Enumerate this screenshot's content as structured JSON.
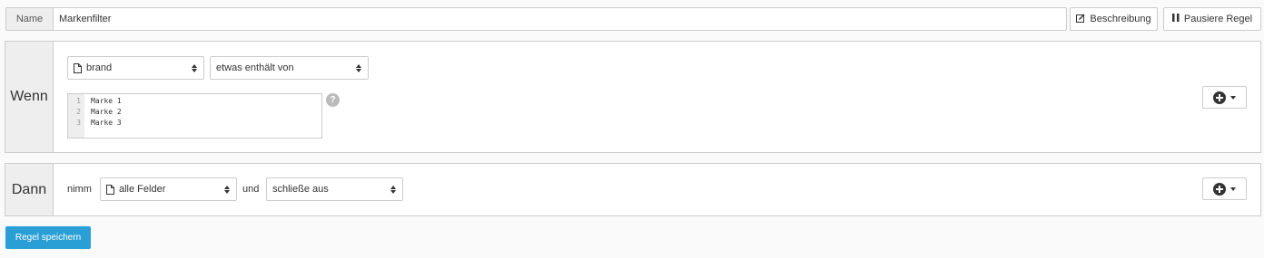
{
  "name_row": {
    "label": "Name",
    "value": "Markenfilter",
    "description_button": "Beschreibung",
    "pause_button": "Pausiere Regel"
  },
  "wenn": {
    "label": "Wenn",
    "field_select": "brand",
    "operator_select": "etwas enthält von",
    "line_numbers": [
      "1",
      "2",
      "3"
    ],
    "code_lines": [
      "Marke 1",
      "Marke 2",
      "Marke 3"
    ],
    "help_glyph": "?"
  },
  "dann": {
    "label": "Dann",
    "take_text": "nimm",
    "fields_select": "alle Felder",
    "and_text": "und",
    "action_select": "schließe aus"
  },
  "save_button": "Regel speichern",
  "icons": {
    "edit": "edit-icon",
    "pause": "pause-icon",
    "file": "file-icon",
    "add": "plus-circle-icon",
    "help": "question-icon"
  },
  "colors": {
    "primary": "#2a9fd6",
    "label_bg": "#eeeeee",
    "border": "#cccccc"
  }
}
